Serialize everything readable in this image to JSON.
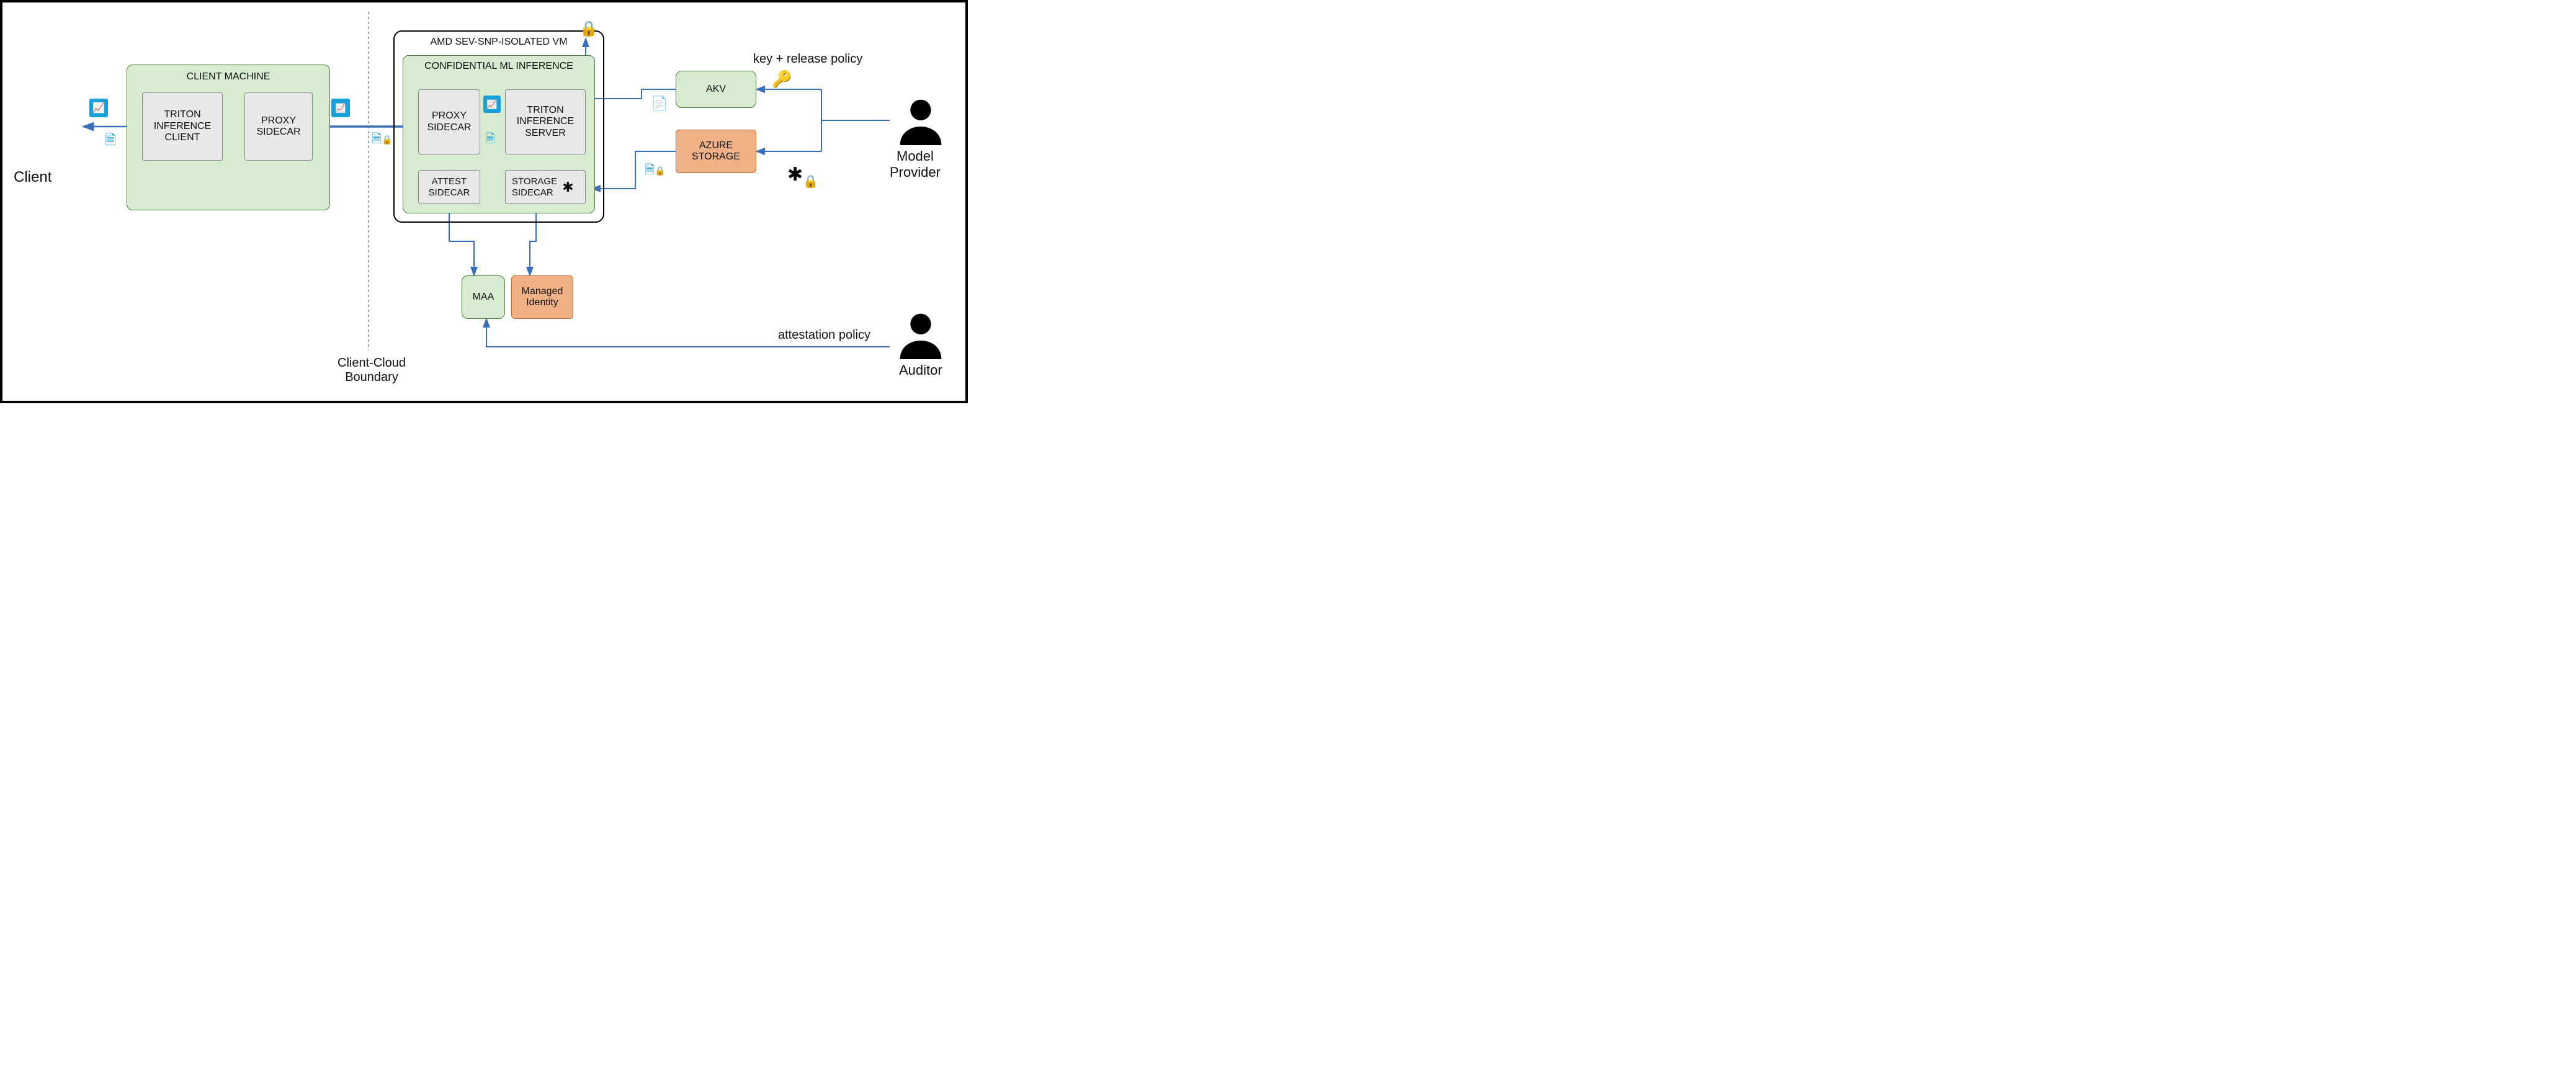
{
  "actors": {
    "client": "Client",
    "model_provider": "Model\nProvider",
    "auditor": "Auditor"
  },
  "boundary_label": "Client-Cloud\nBoundary",
  "client_machine": {
    "title": "CLIENT MACHINE",
    "triton_client": "TRITON\nINFERENCE\nCLIENT",
    "proxy_sidecar": "PROXY\nSIDECAR"
  },
  "vm": {
    "title": "AMD SEV-SNP-ISOLATED VM",
    "conf_title": "CONFIDENTIAL ML INFERENCE",
    "proxy_sidecar": "PROXY\nSIDECAR",
    "triton_server": "TRITON\nINFERENCE\nSERVER",
    "attest_sidecar": "ATTEST\nSIDECAR",
    "storage_sidecar": "STORAGE\nSIDECAR"
  },
  "services": {
    "akv": "AKV",
    "azure_storage": "AZURE\nSTORAGE",
    "maa": "MAA",
    "managed_identity": "Managed\nIdentity"
  },
  "annotations": {
    "key_release": "key + release policy",
    "attestation_policy": "attestation policy"
  },
  "icons": {
    "chart": "chart-doc",
    "binary_doc": "binary-doc",
    "https_doc": "https-doc",
    "lock": "lock",
    "key": "key",
    "cert": "cert-doc",
    "graph_lock": "graph-lock",
    "person": "person"
  }
}
